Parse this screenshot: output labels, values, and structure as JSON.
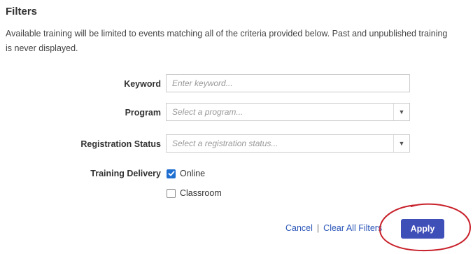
{
  "filters": {
    "title": "Filters",
    "description": "Available training will be limited to events matching all of the criteria provided below. Past and unpublished training is never displayed.",
    "keyword": {
      "label": "Keyword",
      "placeholder": "Enter keyword..."
    },
    "program": {
      "label": "Program",
      "placeholder": "Select a program..."
    },
    "registration_status": {
      "label": "Registration Status",
      "placeholder": "Select a registration status..."
    },
    "training_delivery": {
      "label": "Training Delivery",
      "options": [
        {
          "label": "Online",
          "checked": true
        },
        {
          "label": "Classroom",
          "checked": false
        }
      ]
    },
    "actions": {
      "cancel_label": "Cancel",
      "separator": "|",
      "clear_label": "Clear All Filters",
      "apply_label": "Apply"
    }
  },
  "colors": {
    "accent": "#3f4fb8",
    "link": "#2b56b8",
    "checkbox": "#1f6fd1",
    "annotation": "#c8202a"
  },
  "icons": {
    "dropdown": "caret-down-icon",
    "check": "check-icon"
  }
}
